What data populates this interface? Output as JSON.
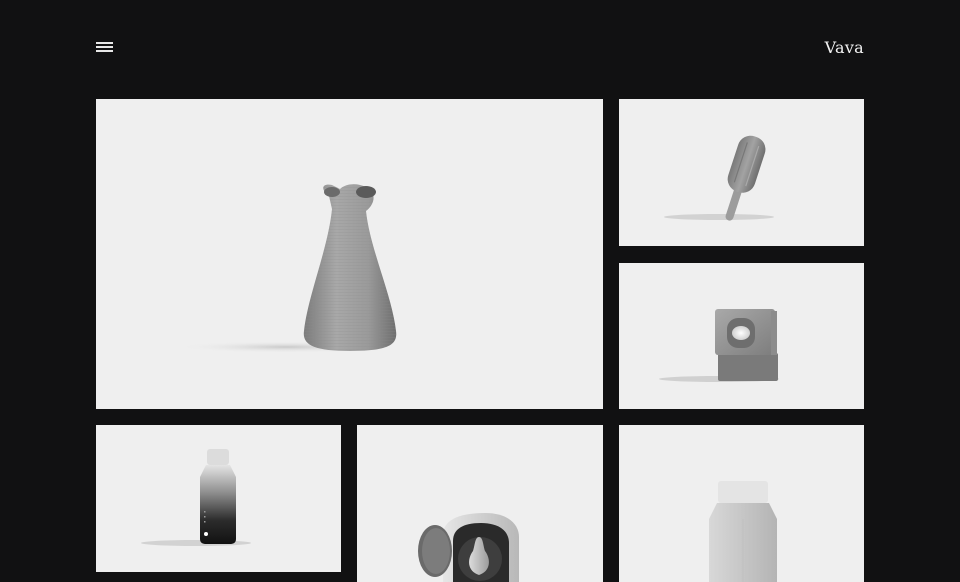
{
  "header": {
    "brand": "Vava",
    "menu_icon": "hamburger-menu-icon"
  },
  "gallery": {
    "items": [
      {
        "name": "vase",
        "icon": "vase-render"
      },
      {
        "name": "popsicle",
        "icon": "popsicle-render"
      },
      {
        "name": "cube-lamp",
        "icon": "cube-lamp-render"
      },
      {
        "name": "gradient-bottle",
        "icon": "bottle-render"
      },
      {
        "name": "pear-frame",
        "icon": "pear-frame-render"
      },
      {
        "name": "milk-bottle",
        "icon": "milk-bottle-render"
      }
    ]
  },
  "colors": {
    "background": "#111112",
    "tile": "#efefef",
    "text": "#f2f2f2"
  }
}
